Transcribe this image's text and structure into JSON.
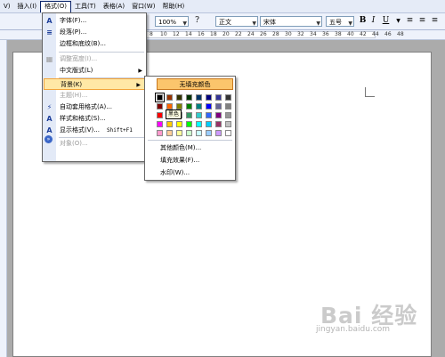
{
  "menubar": {
    "items": [
      "V)",
      "插入(I)",
      "格式(O)",
      "工具(T)",
      "表格(A)",
      "窗口(W)",
      "帮助(H)"
    ]
  },
  "toolbar": {
    "zoom": "100%",
    "style": "正文",
    "font": "宋体",
    "size": "五号",
    "bold": "B",
    "italic": "I",
    "underline": "U"
  },
  "ruler": {
    "numbers": [
      "8",
      "10",
      "12",
      "14",
      "16",
      "18",
      "20",
      "22",
      "24",
      "26",
      "28",
      "30",
      "32",
      "34",
      "36",
      "38",
      "40",
      "42",
      "44",
      "46",
      "48"
    ]
  },
  "format_menu": {
    "items": [
      {
        "label": "字体(F)...",
        "icon": "font-icon",
        "icon_char": "A"
      },
      {
        "label": "段落(P)...",
        "icon": "paragraph-icon",
        "icon_char": "≡"
      },
      {
        "label": "边框和底纹(B)..."
      },
      {
        "label": "调整宽度(I)...",
        "disabled": true,
        "icon": "adjust-width-icon",
        "icon_char": "▦"
      },
      {
        "label": "中文版式(L)",
        "submenu": true
      },
      {
        "label": "背景(K)",
        "submenu": true,
        "highlighted": true
      },
      {
        "label": "主题(H)...",
        "disabled": true
      },
      {
        "label": "自动套用格式(A)...",
        "icon": "autoformat-icon",
        "icon_char": "⚡"
      },
      {
        "label": "样式和格式(S)...",
        "icon": "styles-icon",
        "icon_char": "A"
      },
      {
        "label": "显示格式(V)...",
        "shortcut": "Shift+F1",
        "icon": "reveal-format-icon",
        "icon_char": "A"
      },
      {
        "label": "对象(O)...",
        "disabled": true
      }
    ]
  },
  "background_submenu": {
    "no_fill": "无填充颜色",
    "tooltip": "黑色",
    "more_colors": "其他颜色(M)...",
    "fill_effects": "填充效果(F)...",
    "watermark": "水印(W)...",
    "palette": [
      [
        "#000000",
        "#993300",
        "#333300",
        "#003300",
        "#003366",
        "#000080",
        "#333399",
        "#333333"
      ],
      [
        "#800000",
        "#ff6600",
        "#808000",
        "#008000",
        "#008080",
        "#0000ff",
        "#666699",
        "#808080"
      ],
      [
        "#ff0000",
        "#ff9900",
        "#99cc00",
        "#339966",
        "#33cccc",
        "#3366ff",
        "#800080",
        "#969696"
      ],
      [
        "#ff00ff",
        "#ffcc00",
        "#ffff00",
        "#00ff00",
        "#00ffff",
        "#00ccff",
        "#993366",
        "#c0c0c0"
      ],
      [
        "#ff99cc",
        "#ffcc99",
        "#ffff99",
        "#ccffcc",
        "#ccffff",
        "#99ccff",
        "#cc99ff",
        "#ffffff"
      ]
    ]
  },
  "watermark": {
    "brand": "Bai 经验",
    "url": "jingyan.baidu.com"
  }
}
